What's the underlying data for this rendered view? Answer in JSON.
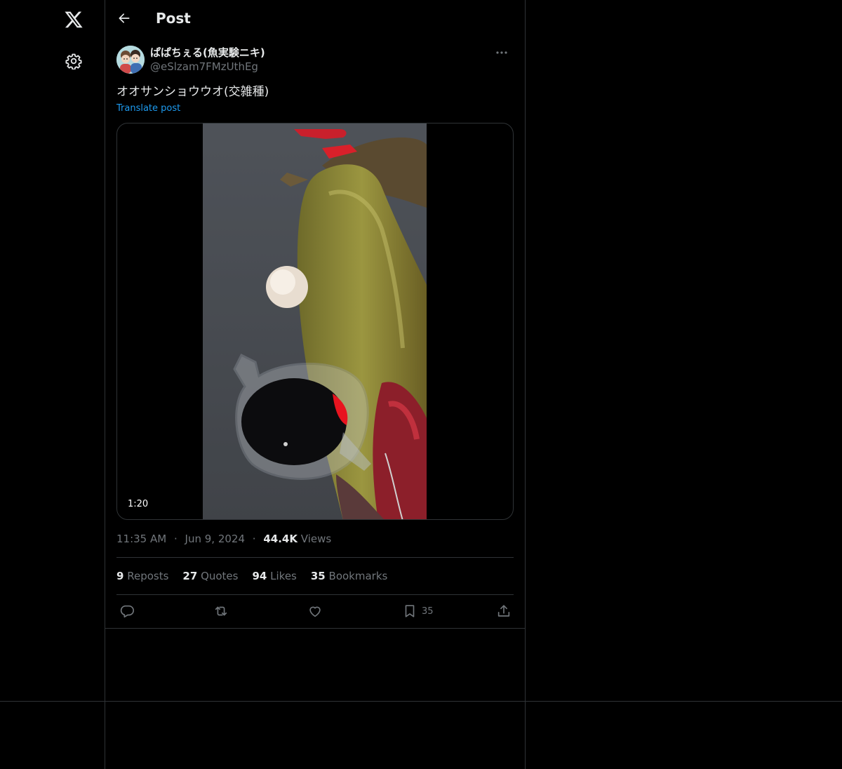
{
  "nav": {
    "logo_icon": "x-logo-icon",
    "settings_icon": "gear-icon"
  },
  "header": {
    "back_icon": "arrow-left-icon",
    "title": "Post"
  },
  "post": {
    "author": {
      "display_name": "ぱぱちぇる(魚実験ニキ)",
      "handle": "@eSlzam7FMzUthEg"
    },
    "more_icon": "more-horizontal-icon",
    "text": "オオサンショウウオ(交雑種)",
    "translate_label": "Translate post",
    "media": {
      "type": "video",
      "duration": "1:20"
    },
    "meta": {
      "time": "11:35 AM",
      "separator": "·",
      "date": "Jun 9, 2024",
      "views_count": "44.4K",
      "views_label": "Views"
    },
    "stats": [
      {
        "count": "9",
        "label": "Reposts"
      },
      {
        "count": "27",
        "label": "Quotes"
      },
      {
        "count": "94",
        "label": "Likes"
      },
      {
        "count": "35",
        "label": "Bookmarks"
      }
    ],
    "actions": {
      "reply_icon": "reply-icon",
      "repost_icon": "repost-icon",
      "like_icon": "heart-icon",
      "bookmark_icon": "bookmark-icon",
      "bookmark_count": "35",
      "share_icon": "share-icon"
    }
  },
  "colors": {
    "background": "#000000",
    "text_primary": "#e7e9ea",
    "text_secondary": "#71767b",
    "border": "#2f3336",
    "link": "#1d9bf0"
  }
}
